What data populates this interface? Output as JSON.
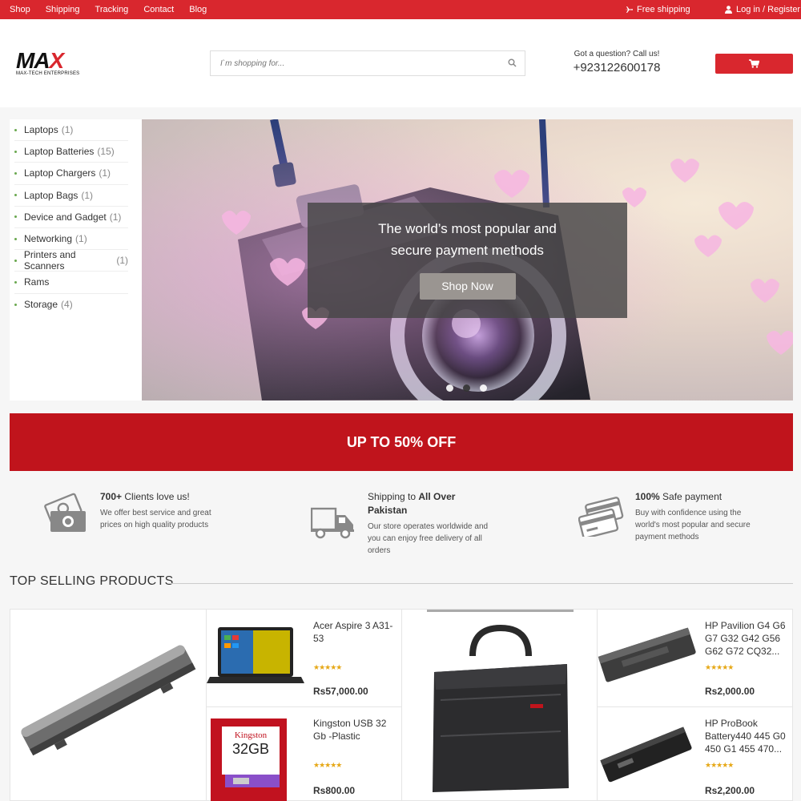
{
  "topbar": {
    "nav": [
      "Shop",
      "Shipping",
      "Tracking",
      "Contact",
      "Blog"
    ],
    "free_shipping": "Free shipping",
    "login": "Log in / Register"
  },
  "header": {
    "logo_text_main": "MAX",
    "logo_text_sub": "MAX-TECH ENTERPRISES",
    "search_placeholder": "I`m shopping for...",
    "call_label": "Got a question? Call us!",
    "phone": "+923122600178"
  },
  "sidebar": {
    "categories": [
      {
        "label": "Laptops",
        "count": "(1)"
      },
      {
        "label": "Laptop Batteries",
        "count": "(15)"
      },
      {
        "label": "Laptop Chargers",
        "count": "(1)"
      },
      {
        "label": "Laptop Bags",
        "count": "(1)"
      },
      {
        "label": "Device and Gadget",
        "count": "(1)"
      },
      {
        "label": "Networking",
        "count": "(1)"
      },
      {
        "label": "Printers and Scanners",
        "count": "(1)"
      },
      {
        "label": "Rams",
        "count": ""
      },
      {
        "label": "Storage",
        "count": "(4)"
      }
    ]
  },
  "slider": {
    "caption_line1": "The world’s most popular and",
    "caption_line2": "secure payment methods",
    "button": "Shop Now",
    "slides": 3,
    "active_slide": 2
  },
  "promo": {
    "text": "UP TO 50% OFF"
  },
  "features": [
    {
      "title_bold": "700+",
      "title_rest": " Clients love us!",
      "desc_line1": "We offer best service and great",
      "desc_line2": "prices on high quality products",
      "desc_line3": "",
      "icon": "money-icon"
    },
    {
      "title_pre": "Shipping to ",
      "title_bold": "All Over",
      "title_line2": "Pakistan",
      "desc_line1": "Our store operates worldwide and",
      "desc_line2": "you can enjoy free delivery of all",
      "desc_line3": "orders",
      "icon": "truck-icon"
    },
    {
      "title_bold": "100%",
      "title_rest": " Safe payment",
      "desc_line1": "Buy with confidence using the",
      "desc_line2": "world's most popular and secure",
      "desc_line3": "payment methods",
      "icon": "credit-card-icon"
    }
  ],
  "section": {
    "title": "TOP SELLING PRODUCTS"
  },
  "products": [
    {
      "name_line1": "Acer Aspire 3 A31-",
      "name_line2": "53",
      "name_line3": "",
      "rating": 4.5,
      "price": "Rs57,000.00"
    },
    {
      "name_line1": "Kingston USB 32",
      "name_line2": "Gb -Plastic",
      "name_line3": "",
      "rating": 4.5,
      "price": "Rs800.00"
    },
    {
      "name_line1": "HP Pavilion G4 G6",
      "name_line2": "G7 G32 G42 G56",
      "name_line3": "G62 G72 CQ32...",
      "rating": 4.5,
      "price": "Rs2,000.00"
    },
    {
      "name_line1": "HP ProBook",
      "name_line2": "Battery440 445 G0",
      "name_line3": "450 G1 455 470...",
      "rating": 4.5,
      "price": "Rs2,200.00"
    }
  ],
  "colors": {
    "brand_red": "#d9272e",
    "promo_red": "#c0141c",
    "star": "#e6a817"
  }
}
